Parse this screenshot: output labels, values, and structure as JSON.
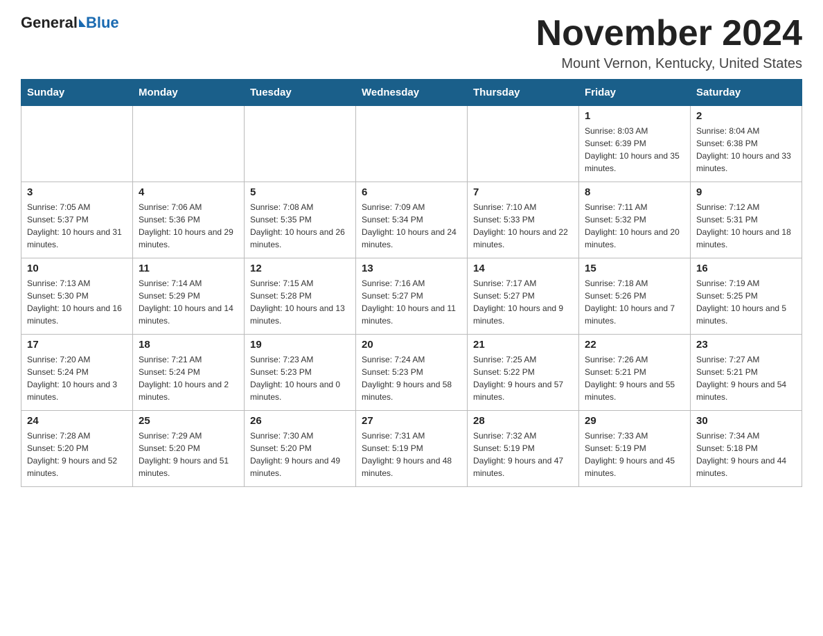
{
  "header": {
    "logo_general": "General",
    "logo_blue": "Blue",
    "month_title": "November 2024",
    "location": "Mount Vernon, Kentucky, United States"
  },
  "weekdays": [
    "Sunday",
    "Monday",
    "Tuesday",
    "Wednesday",
    "Thursday",
    "Friday",
    "Saturday"
  ],
  "weeks": [
    [
      {
        "day": "",
        "sunrise": "",
        "sunset": "",
        "daylight": ""
      },
      {
        "day": "",
        "sunrise": "",
        "sunset": "",
        "daylight": ""
      },
      {
        "day": "",
        "sunrise": "",
        "sunset": "",
        "daylight": ""
      },
      {
        "day": "",
        "sunrise": "",
        "sunset": "",
        "daylight": ""
      },
      {
        "day": "",
        "sunrise": "",
        "sunset": "",
        "daylight": ""
      },
      {
        "day": "1",
        "sunrise": "Sunrise: 8:03 AM",
        "sunset": "Sunset: 6:39 PM",
        "daylight": "Daylight: 10 hours and 35 minutes."
      },
      {
        "day": "2",
        "sunrise": "Sunrise: 8:04 AM",
        "sunset": "Sunset: 6:38 PM",
        "daylight": "Daylight: 10 hours and 33 minutes."
      }
    ],
    [
      {
        "day": "3",
        "sunrise": "Sunrise: 7:05 AM",
        "sunset": "Sunset: 5:37 PM",
        "daylight": "Daylight: 10 hours and 31 minutes."
      },
      {
        "day": "4",
        "sunrise": "Sunrise: 7:06 AM",
        "sunset": "Sunset: 5:36 PM",
        "daylight": "Daylight: 10 hours and 29 minutes."
      },
      {
        "day": "5",
        "sunrise": "Sunrise: 7:08 AM",
        "sunset": "Sunset: 5:35 PM",
        "daylight": "Daylight: 10 hours and 26 minutes."
      },
      {
        "day": "6",
        "sunrise": "Sunrise: 7:09 AM",
        "sunset": "Sunset: 5:34 PM",
        "daylight": "Daylight: 10 hours and 24 minutes."
      },
      {
        "day": "7",
        "sunrise": "Sunrise: 7:10 AM",
        "sunset": "Sunset: 5:33 PM",
        "daylight": "Daylight: 10 hours and 22 minutes."
      },
      {
        "day": "8",
        "sunrise": "Sunrise: 7:11 AM",
        "sunset": "Sunset: 5:32 PM",
        "daylight": "Daylight: 10 hours and 20 minutes."
      },
      {
        "day": "9",
        "sunrise": "Sunrise: 7:12 AM",
        "sunset": "Sunset: 5:31 PM",
        "daylight": "Daylight: 10 hours and 18 minutes."
      }
    ],
    [
      {
        "day": "10",
        "sunrise": "Sunrise: 7:13 AM",
        "sunset": "Sunset: 5:30 PM",
        "daylight": "Daylight: 10 hours and 16 minutes."
      },
      {
        "day": "11",
        "sunrise": "Sunrise: 7:14 AM",
        "sunset": "Sunset: 5:29 PM",
        "daylight": "Daylight: 10 hours and 14 minutes."
      },
      {
        "day": "12",
        "sunrise": "Sunrise: 7:15 AM",
        "sunset": "Sunset: 5:28 PM",
        "daylight": "Daylight: 10 hours and 13 minutes."
      },
      {
        "day": "13",
        "sunrise": "Sunrise: 7:16 AM",
        "sunset": "Sunset: 5:27 PM",
        "daylight": "Daylight: 10 hours and 11 minutes."
      },
      {
        "day": "14",
        "sunrise": "Sunrise: 7:17 AM",
        "sunset": "Sunset: 5:27 PM",
        "daylight": "Daylight: 10 hours and 9 minutes."
      },
      {
        "day": "15",
        "sunrise": "Sunrise: 7:18 AM",
        "sunset": "Sunset: 5:26 PM",
        "daylight": "Daylight: 10 hours and 7 minutes."
      },
      {
        "day": "16",
        "sunrise": "Sunrise: 7:19 AM",
        "sunset": "Sunset: 5:25 PM",
        "daylight": "Daylight: 10 hours and 5 minutes."
      }
    ],
    [
      {
        "day": "17",
        "sunrise": "Sunrise: 7:20 AM",
        "sunset": "Sunset: 5:24 PM",
        "daylight": "Daylight: 10 hours and 3 minutes."
      },
      {
        "day": "18",
        "sunrise": "Sunrise: 7:21 AM",
        "sunset": "Sunset: 5:24 PM",
        "daylight": "Daylight: 10 hours and 2 minutes."
      },
      {
        "day": "19",
        "sunrise": "Sunrise: 7:23 AM",
        "sunset": "Sunset: 5:23 PM",
        "daylight": "Daylight: 10 hours and 0 minutes."
      },
      {
        "day": "20",
        "sunrise": "Sunrise: 7:24 AM",
        "sunset": "Sunset: 5:23 PM",
        "daylight": "Daylight: 9 hours and 58 minutes."
      },
      {
        "day": "21",
        "sunrise": "Sunrise: 7:25 AM",
        "sunset": "Sunset: 5:22 PM",
        "daylight": "Daylight: 9 hours and 57 minutes."
      },
      {
        "day": "22",
        "sunrise": "Sunrise: 7:26 AM",
        "sunset": "Sunset: 5:21 PM",
        "daylight": "Daylight: 9 hours and 55 minutes."
      },
      {
        "day": "23",
        "sunrise": "Sunrise: 7:27 AM",
        "sunset": "Sunset: 5:21 PM",
        "daylight": "Daylight: 9 hours and 54 minutes."
      }
    ],
    [
      {
        "day": "24",
        "sunrise": "Sunrise: 7:28 AM",
        "sunset": "Sunset: 5:20 PM",
        "daylight": "Daylight: 9 hours and 52 minutes."
      },
      {
        "day": "25",
        "sunrise": "Sunrise: 7:29 AM",
        "sunset": "Sunset: 5:20 PM",
        "daylight": "Daylight: 9 hours and 51 minutes."
      },
      {
        "day": "26",
        "sunrise": "Sunrise: 7:30 AM",
        "sunset": "Sunset: 5:20 PM",
        "daylight": "Daylight: 9 hours and 49 minutes."
      },
      {
        "day": "27",
        "sunrise": "Sunrise: 7:31 AM",
        "sunset": "Sunset: 5:19 PM",
        "daylight": "Daylight: 9 hours and 48 minutes."
      },
      {
        "day": "28",
        "sunrise": "Sunrise: 7:32 AM",
        "sunset": "Sunset: 5:19 PM",
        "daylight": "Daylight: 9 hours and 47 minutes."
      },
      {
        "day": "29",
        "sunrise": "Sunrise: 7:33 AM",
        "sunset": "Sunset: 5:19 PM",
        "daylight": "Daylight: 9 hours and 45 minutes."
      },
      {
        "day": "30",
        "sunrise": "Sunrise: 7:34 AM",
        "sunset": "Sunset: 5:18 PM",
        "daylight": "Daylight: 9 hours and 44 minutes."
      }
    ]
  ]
}
